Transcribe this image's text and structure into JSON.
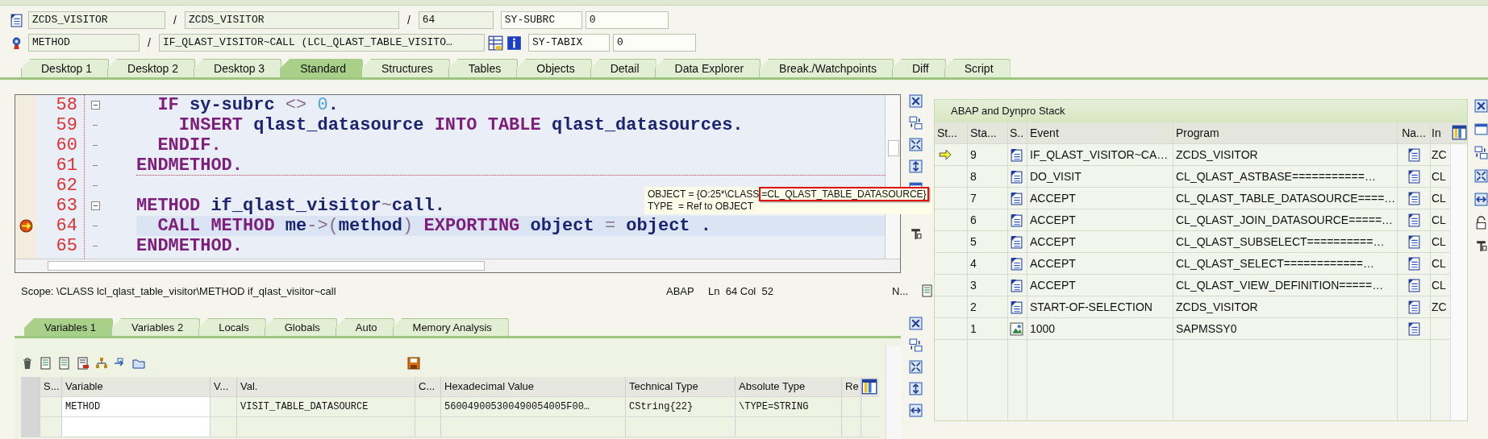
{
  "header": {
    "rows": [
      {
        "fields": [
          {
            "value": "ZCDS_VISITOR"
          },
          {
            "sep": "/",
            "value": "ZCDS_VISITOR"
          },
          {
            "sep": "/",
            "value": "64"
          }
        ],
        "sys_label": "SY-SUBRC",
        "sys_value": "0"
      },
      {
        "fields": [
          {
            "value": "METHOD"
          },
          {
            "sep": "/",
            "value": "IF_QLAST_VISITOR~CALL (LCL_QLAST_TABLE_VISITO…"
          }
        ],
        "sys_label": "SY-TABIX",
        "sys_value": "0"
      }
    ]
  },
  "tabs": [
    {
      "label": "Desktop 1",
      "selected": false
    },
    {
      "label": "Desktop 2",
      "selected": false
    },
    {
      "label": "Desktop 3",
      "selected": false
    },
    {
      "label": "Standard",
      "selected": true
    },
    {
      "label": "Structures",
      "selected": false
    },
    {
      "label": "Tables",
      "selected": false
    },
    {
      "label": "Objects",
      "selected": false
    },
    {
      "label": "Detail",
      "selected": false
    },
    {
      "label": "Data Explorer",
      "selected": false
    },
    {
      "label": "Break./Watchpoints",
      "selected": false
    },
    {
      "label": "Diff",
      "selected": false
    },
    {
      "label": "Script",
      "selected": false
    }
  ],
  "editor": {
    "lines": [
      {
        "number": "58",
        "fold": true,
        "separator": false,
        "current": false,
        "tokens": [
          {
            "kind": "keyword",
            "text": "  IF"
          },
          {
            "kind": "name",
            "text": " sy-subrc"
          },
          {
            "kind": "operator",
            "text": " <> "
          },
          {
            "kind": "number",
            "text": "0"
          },
          {
            "kind": "name",
            "text": "."
          }
        ]
      },
      {
        "number": "59",
        "fold": false,
        "separator": false,
        "current": false,
        "tokens": [
          {
            "kind": "keyword",
            "text": "    INSERT"
          },
          {
            "kind": "name",
            "text": " qlast_datasource"
          },
          {
            "kind": "keyword",
            "text": " INTO TABLE"
          },
          {
            "kind": "name",
            "text": " qlast_datasources."
          }
        ]
      },
      {
        "number": "60",
        "fold": false,
        "separator": false,
        "current": false,
        "tokens": [
          {
            "kind": "keyword",
            "text": "  ENDIF."
          }
        ]
      },
      {
        "number": "61",
        "fold": false,
        "separator": true,
        "current": false,
        "tokens": [
          {
            "kind": "keyword",
            "text": "ENDMETHOD."
          }
        ]
      },
      {
        "number": "62",
        "fold": false,
        "separator": false,
        "current": false
      },
      {
        "number": "63",
        "fold": true,
        "separator": false,
        "current": false,
        "tokens": [
          {
            "kind": "keyword",
            "text": "METHOD"
          },
          {
            "kind": "name",
            "text": " if_qlast_visitor"
          },
          {
            "kind": "operator",
            "text": "~"
          },
          {
            "kind": "name",
            "text": "call."
          }
        ]
      },
      {
        "number": "64",
        "fold": false,
        "separator": false,
        "current": true,
        "tokens": [
          {
            "kind": "keyword",
            "text": "  CALL METHOD"
          },
          {
            "kind": "name",
            "text": " me"
          },
          {
            "kind": "operator",
            "text": "->("
          },
          {
            "kind": "name",
            "text": "method"
          },
          {
            "kind": "operator",
            "text": ")"
          },
          {
            "kind": "keyword",
            "text": " EXPORTING"
          },
          {
            "kind": "name",
            "text": " object"
          },
          {
            "kind": "operator",
            "text": " = "
          },
          {
            "kind": "name",
            "text": "object ."
          }
        ]
      },
      {
        "number": "65",
        "fold": false,
        "separator": false,
        "current": false,
        "tokens": [
          {
            "kind": "keyword",
            "text": "ENDMETHOD."
          }
        ]
      }
    ],
    "tooltip": {
      "lines": [
        {
          "text": "OBJECT = {O:25*\\CLASS",
          "highlight": "=CL_QLAST_TABLE_DATASOURCE}"
        },
        {
          "text": "TYPE  = Ref to OBJECT"
        }
      ]
    },
    "status": {
      "scope": "Scope: \\CLASS lcl_qlast_table_visitor\\METHOD if_qlast_visitor~call",
      "language": "ABAP",
      "position": "Ln  64 Col  52",
      "mode": "N..."
    }
  },
  "variables": {
    "tabs": [
      {
        "label": "Variables 1",
        "selected": true
      },
      {
        "label": "Variables 2",
        "selected": false
      },
      {
        "label": "Locals",
        "selected": false
      },
      {
        "label": "Globals",
        "selected": false
      },
      {
        "label": "Auto",
        "selected": false
      },
      {
        "label": "Memory Analysis",
        "selected": false
      }
    ],
    "columns": [
      "S...",
      "Variable",
      "V...",
      "Val.",
      "C...",
      "Hexadecimal Value",
      "Technical Type",
      "Absolute Type",
      "Re"
    ],
    "rows": [
      [
        "",
        "METHOD",
        "",
        "VISIT_TABLE_DATASOURCE",
        "",
        "560049005300490054005F00…",
        "CString{22}",
        "\\TYPE=STRING",
        ""
      ]
    ]
  },
  "stack": {
    "title": "ABAP and Dynpro Stack",
    "columns": [
      "St...",
      "Sta...",
      "S..",
      "Event",
      "Program",
      "Na...",
      "In"
    ],
    "rows": [
      {
        "current": true,
        "level": "9",
        "kind": "method",
        "event": "IF_QLAST_VISITOR~CA…",
        "program": "ZCDS_VISITOR",
        "include": "ZC"
      },
      {
        "current": false,
        "level": "8",
        "kind": "method",
        "event": "DO_VISIT",
        "program": "CL_QLAST_ASTBASE===========…",
        "include": "CL"
      },
      {
        "current": false,
        "level": "7",
        "kind": "method",
        "event": "ACCEPT",
        "program": "CL_QLAST_TABLE_DATASOURCE====…",
        "include": "CL"
      },
      {
        "current": false,
        "level": "6",
        "kind": "method",
        "event": "ACCEPT",
        "program": "CL_QLAST_JOIN_DATASOURCE=====…",
        "include": "CL"
      },
      {
        "current": false,
        "level": "5",
        "kind": "method",
        "event": "ACCEPT",
        "program": "CL_QLAST_SUBSELECT==========…",
        "include": "CL"
      },
      {
        "current": false,
        "level": "4",
        "kind": "method",
        "event": "ACCEPT",
        "program": "CL_QLAST_SELECT============…",
        "include": "CL"
      },
      {
        "current": false,
        "level": "3",
        "kind": "method",
        "event": "ACCEPT",
        "program": "CL_QLAST_VIEW_DEFINITION=====…",
        "include": "CL"
      },
      {
        "current": false,
        "level": "2",
        "kind": "method",
        "event": "START-OF-SELECTION",
        "program": "ZCDS_VISITOR",
        "include": "ZC"
      },
      {
        "current": false,
        "level": "1",
        "kind": "screen",
        "event": "1000",
        "program": "SAPMSSY0",
        "include": ""
      }
    ]
  }
}
